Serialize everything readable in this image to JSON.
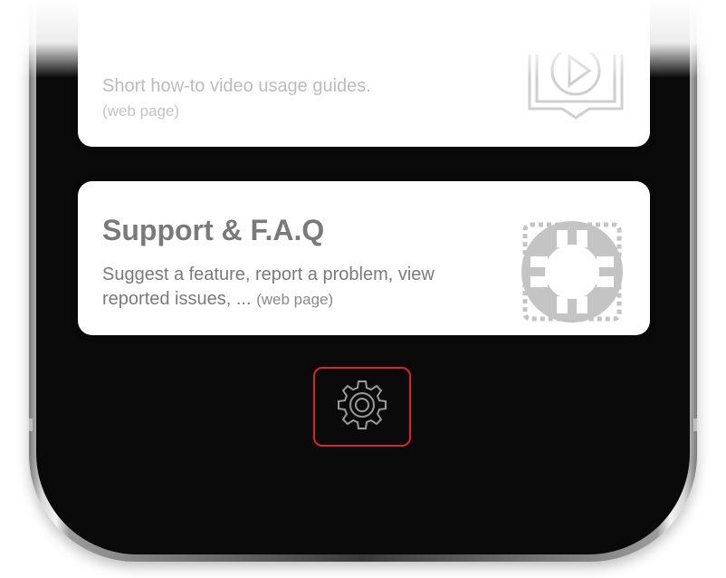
{
  "cards": [
    {
      "title": "",
      "description": "Short how-to video usage guides.",
      "note": "(web page)",
      "icon": "video-guide-icon"
    },
    {
      "title": "Support & F.A.Q",
      "description": "Suggest a feature, report a problem, view reported issues, ...",
      "note": "(web page)",
      "icon": "lifebuoy-icon"
    }
  ],
  "settings": {
    "icon": "gear-icon",
    "highlight_color": "#d9242a"
  },
  "colors": {
    "text_primary": "#7a7a7a",
    "text_faded": "#bcbcbc",
    "icon_gray": "#c4c4c4"
  }
}
